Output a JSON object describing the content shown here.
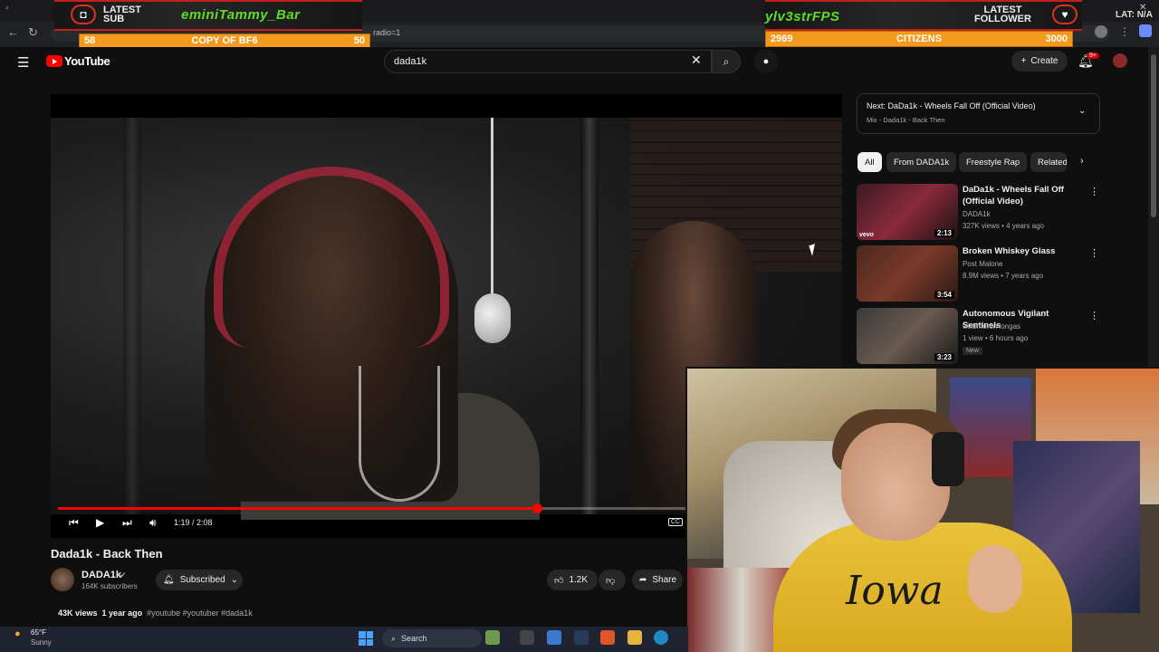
{
  "overlay": {
    "left_label_1": "LATEST",
    "left_label_2": "SUB",
    "latest_sub_name": "eminiTammy_Bar",
    "right_label_1": "LATEST",
    "right_label_2": "FOLLOWER",
    "latest_follower_name": "ylv3strFPS",
    "goal_left": {
      "current": "58",
      "title": "COPY OF BF6",
      "target": "50"
    },
    "goal_right": {
      "current": "2969",
      "title": "CITIZENS",
      "target": "3000"
    },
    "category": "LAT: N/A",
    "accent": "#c2201c",
    "goal_color": "#f39a1e"
  },
  "browser": {
    "address_fragment": "radio=1"
  },
  "header": {
    "logo_text": "YouTube",
    "search_value": "dada1k",
    "create_label": "Create",
    "notifications_badge": "9+"
  },
  "player": {
    "time": "1:19 / 2:08",
    "cc_label": "CC",
    "progress": 0.617
  },
  "video": {
    "title": "Dada1k - Back Then",
    "channel": "DADA1k",
    "subscribers": "164K subscribers",
    "subscribe_label": "Subscribed",
    "likes": "1.2K",
    "share_label": "Share",
    "views": "43K views",
    "age": "1 year ago",
    "tags": "#youtube #youtuber #dada1k"
  },
  "up_next": {
    "title": "Next: DaDa1k - Wheels Fall Off (Official Video)",
    "subtitle": "Mix - Dada1k - Back Then"
  },
  "chips": [
    "All",
    "From DADA1k",
    "Freestyle Rap",
    "Related"
  ],
  "recommendations": [
    {
      "title": "DaDa1k - Wheels Fall Off (Official Video)",
      "channel": "DADA1k",
      "meta": "327K views • 4 years ago",
      "duration": "2:13",
      "badge": "",
      "thumb_label": "vevo"
    },
    {
      "title": "Broken Whiskey Glass",
      "channel": "Post Malone",
      "meta": "8.9M views • 7 years ago",
      "duration": "3:54",
      "badge": "",
      "thumb_label": ""
    },
    {
      "title": "Autonomous Vigilant Sentinels",
      "channel": "willbmoron longas",
      "meta": "1 view • 6 hours ago",
      "duration": "3:23",
      "badge": "New",
      "thumb_label": ""
    }
  ],
  "webcam": {
    "jersey_text": "Iowa"
  },
  "taskbar": {
    "temperature": "65°F",
    "condition": "Sunny",
    "search_label": "Search"
  }
}
